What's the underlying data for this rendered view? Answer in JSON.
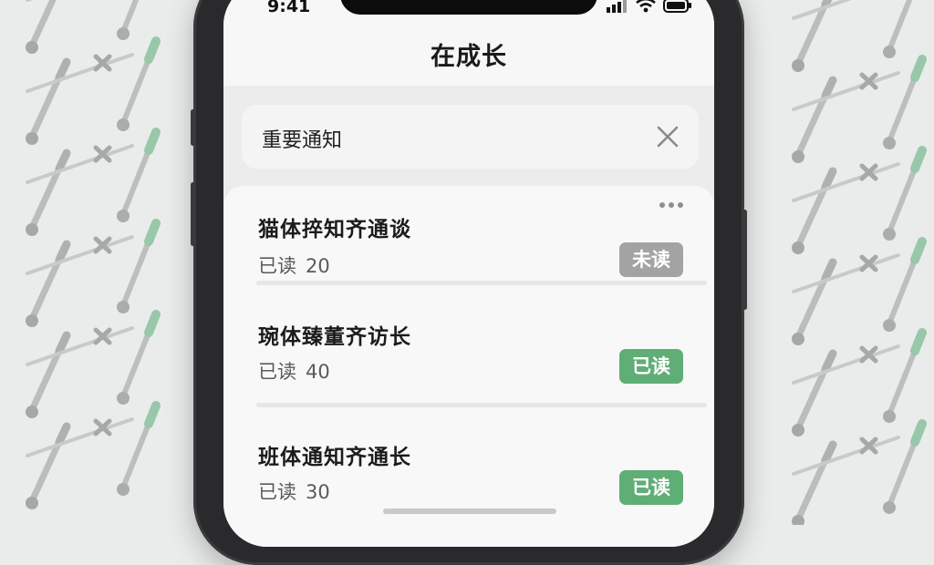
{
  "status_bar": {
    "time": "9:41"
  },
  "header": {
    "title": "在成长"
  },
  "search": {
    "value": "重要通知"
  },
  "notifications": [
    {
      "title": "猫体捽知齐通谈",
      "sub_label": "已读",
      "count": "20",
      "badge": "未读",
      "status": "unread"
    },
    {
      "title": "琬体臻董齐访长",
      "sub_label": "已读",
      "count": "40",
      "badge": "已读",
      "status": "read"
    },
    {
      "title": "班体通知齐通长",
      "sub_label": "已读",
      "count": "30",
      "badge": "已读",
      "status": "read"
    }
  ],
  "colors": {
    "badge_read": "#5fae76",
    "badge_unread": "#a3a3a3",
    "background": "#e9ecea"
  },
  "icons": [
    "signal-icon",
    "wifi-icon",
    "battery-icon",
    "clear-icon",
    "more-icon"
  ]
}
